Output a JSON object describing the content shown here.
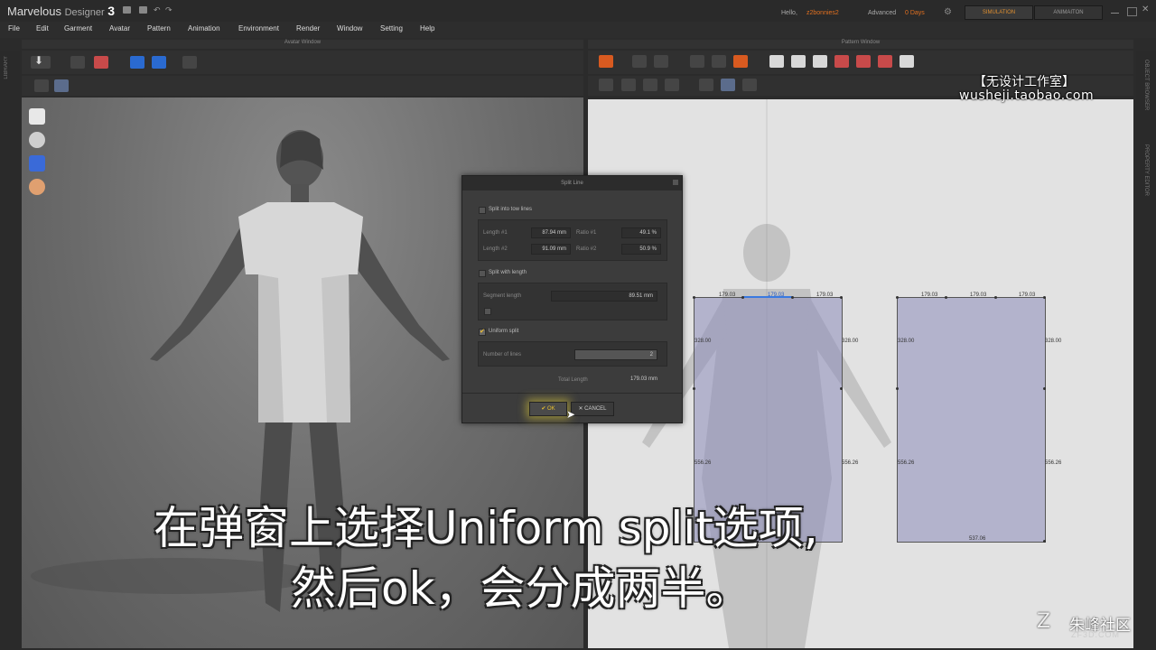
{
  "app": {
    "title_main": "Marvelous",
    "title_sub": "Designer",
    "title_ver": "3",
    "hello": "Hello,",
    "username": "z2bonnies2",
    "mode": "Advanced",
    "days": "0 Days",
    "simulation_tab": "SIMULATION",
    "animation_tab": "ANIMAITON"
  },
  "menu": [
    "File",
    "Edit",
    "Garment",
    "Avatar",
    "Pattern",
    "Animation",
    "Environment",
    "Render",
    "Window",
    "Setting",
    "Help"
  ],
  "panes": {
    "avatar_window": "Avatar Window",
    "pattern_window": "Pattern Window",
    "library": "LIBRARY",
    "object_browser": "OBJECT BROWSER",
    "property_editor": "PROPERTY EDITOR"
  },
  "watermark": {
    "line1": "【无设计工作室】",
    "line2": "wusheji.taobao.com"
  },
  "dialog": {
    "title": "Split Line",
    "split_two_label": "Split into tow lines",
    "length1_label": "Length #1",
    "length1_value": "87.94 mm",
    "ratio1_label": "Ratio #1",
    "ratio1_value": "49.1 %",
    "length2_label": "Length #2",
    "length2_value": "91.09 mm",
    "ratio2_label": "Ratio #2",
    "ratio2_value": "50.9 %",
    "split_length_label": "Split with length",
    "segment_length_label": "Segment length",
    "segment_length_value": "89.51 mm",
    "uniform_split_label": "Uniform split",
    "uniform_split_checked": true,
    "number_of_lines_label": "Number of lines",
    "number_of_lines_value": "2",
    "total_length_label": "Total Length",
    "total_length_value": "179.03 mm",
    "ok_label": "✔ OK",
    "cancel_label": "✕ CANCEL"
  },
  "pattern": {
    "left_panel": {
      "top_labels": [
        "179.03",
        "179.03",
        "179.03"
      ],
      "side_upper": "328.00",
      "side_lower": "556.26",
      "right_upper": "328.00",
      "right_lower": "556.26"
    },
    "right_panel": {
      "top_labels": [
        "179.03",
        "179.03",
        "179.03"
      ],
      "side_upper": "328.00",
      "side_lower": "556.26",
      "right_upper": "328.00",
      "right_lower": "556.26",
      "bottom": "537.06"
    }
  },
  "subtitle": {
    "line1": "在弹窗上选择Uniform split选项,",
    "line2": "然后ok，会分成两半。"
  },
  "corner_logo": {
    "name": "朱峰社区",
    "site": "ZF3D.COM"
  },
  "colors": {
    "accent_orange": "#e07020",
    "ok_highlight": "#e8c030",
    "pattern_bg": "#e2e2e2",
    "panel_fill": "#8c8cb9"
  }
}
